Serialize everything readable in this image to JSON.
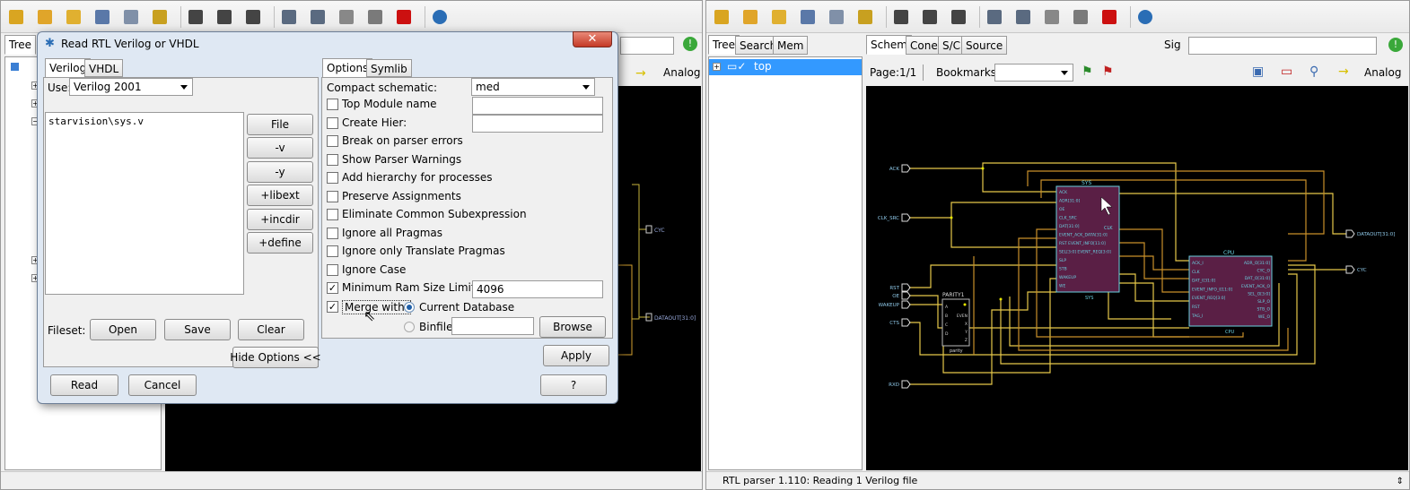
{
  "left": {
    "tab_tree": "Tree",
    "canvas_labels": {
      "analog": "Analog",
      "cyc": "CYC",
      "dataout": "DATAOUT[31:0]"
    }
  },
  "dialog": {
    "title": "Read RTL Verilog or VHDL",
    "tabs": {
      "verilog": "Verilog",
      "vhdl": "VHDL",
      "options": "Options",
      "symlib": "Symlib"
    },
    "use_label": "Use:",
    "use_value": "Verilog 2001",
    "file_text": "starvision\\sys.v",
    "file_buttons": [
      "File",
      "-v",
      "-y",
      "+libext",
      "+incdir",
      "+define"
    ],
    "fileset_label": "Fileset:",
    "open": "Open",
    "save": "Save",
    "clear": "Clear",
    "hide_options": "Hide Options <<",
    "read": "Read",
    "cancel": "Cancel",
    "apply": "Apply",
    "help": "?",
    "compact_label": "Compact schematic:",
    "compact_value": "med",
    "options": [
      {
        "label": "Top Module name",
        "checked": false
      },
      {
        "label": "Create Hier:",
        "checked": false
      },
      {
        "label": "Break on parser errors",
        "checked": false
      },
      {
        "label": "Show Parser Warnings",
        "checked": false
      },
      {
        "label": "Add hierarchy for processes",
        "checked": false
      },
      {
        "label": "Preserve Assignments",
        "checked": false
      },
      {
        "label": "Eliminate Common Subexpression",
        "checked": false
      },
      {
        "label": "Ignore all Pragmas",
        "checked": false
      },
      {
        "label": "Ignore only Translate Pragmas",
        "checked": false
      },
      {
        "label": "Ignore Case",
        "checked": false
      },
      {
        "label": "Minimum Ram Size Limit",
        "checked": true
      },
      {
        "label": "Merge with:",
        "checked": true
      }
    ],
    "ram_size": "4096",
    "current_db": "Current Database",
    "binfile": "Binfile",
    "browse": "Browse"
  },
  "right": {
    "tabs_left": {
      "tree": "Tree",
      "search": "Search",
      "mem": "Mem"
    },
    "tabs_main": {
      "schem": "Schem",
      "cone": "Cone",
      "sc": "S/C",
      "source": "Source"
    },
    "sig_label": "Sig",
    "tree_item": "top",
    "page_label": "Page:",
    "page_value": "1/1",
    "bookmarks_label": "Bookmarks:",
    "analog": "Analog",
    "status": "RTL parser 1.110: Reading 1 Verilog file",
    "ports_in": [
      "ACK",
      "CLK_SRC",
      "RST",
      "OE",
      "WAKEUP",
      "CTS",
      "RXD"
    ],
    "ports_out": [
      "DATAOUT[31:0]",
      "CYC"
    ],
    "sys": {
      "title": "SYS",
      "name": "SYS",
      "pins": [
        "ACK",
        "ADR[31:0]",
        "OE",
        "CLK_SRC",
        "DAT[31:0]",
        "EVENT_ACK_DATA[31:0]",
        "RST EVENT_INFO[11:0]",
        "SEL[3:0] EVENT_REQ[3:0]",
        "SLP",
        "STB",
        "WAKEUP",
        "WE"
      ],
      "pin_clk": "CLK"
    },
    "cpu": {
      "title": "CPU",
      "name": "CPU",
      "pins_l": [
        "ACK_I",
        "CLK",
        "DAT_I[31:0]",
        "EVENT_INFO_I[11:0]",
        "EVENT_REQ[3:0]",
        "RST",
        "TAG_I"
      ],
      "pins_r": [
        "ADR_O[31:0]",
        "CYC_O",
        "DAT_O[31:0]",
        "EVENT_ACK_O",
        "SEL_O[3:0]",
        "SLP_O",
        "STB_O",
        "WE_O"
      ]
    },
    "parity": {
      "title": "PARITY1",
      "name": "parity",
      "pins": [
        "A",
        "B",
        "C",
        "D"
      ],
      "pins_r": [
        "EVEN",
        "X",
        "Y",
        "Z"
      ]
    }
  }
}
